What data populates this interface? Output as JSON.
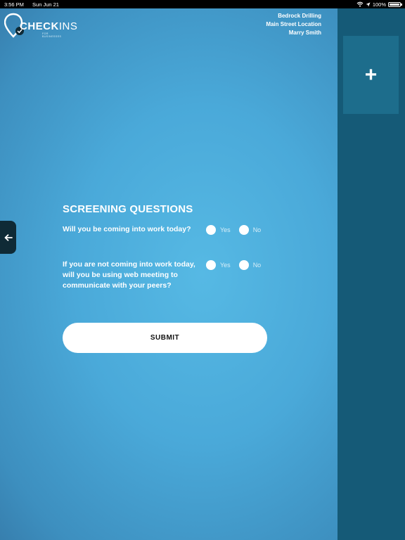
{
  "status_bar": {
    "time": "3:56 PM",
    "date": "Sun Jun 21",
    "battery": "100%"
  },
  "logo": {
    "text_bold": "CHECK",
    "text_thin": "INS",
    "tagline": "FOR BUSINESSES"
  },
  "company": {
    "name": "Bedrock Drilling",
    "location": "Main Street Location",
    "user": "Marry Smith"
  },
  "side_panel": {
    "add_icon": "+"
  },
  "screening": {
    "title": "SCREENING QUESTIONS",
    "questions": [
      {
        "text": "Will you be coming into work today?",
        "yes_label": "Yes",
        "no_label": "No"
      },
      {
        "text": "If you are not coming into work today, will you be using web meeting to communicate with your peers?",
        "yes_label": "Yes",
        "no_label": "No"
      }
    ],
    "submit_label": "SUBMIT"
  },
  "colors": {
    "panel_dark": "#155a77",
    "accent_blue": "#4aa9d9",
    "back_tab": "#0f2a36"
  }
}
